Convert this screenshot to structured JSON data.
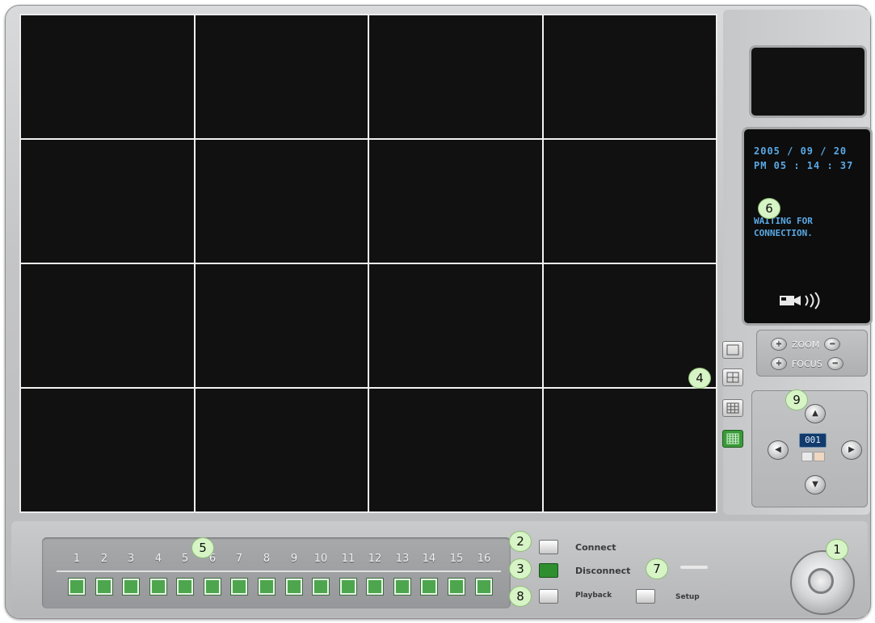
{
  "status": {
    "date": "2005 / 09 / 20",
    "time": "PM 05 : 14 : 37",
    "message": "WAITING FOR CONNECTION."
  },
  "zoom_label": "ZOOM",
  "focus_label": "FOCUS",
  "ptz": {
    "channel": "001"
  },
  "channels": [
    "1",
    "2",
    "3",
    "4",
    "5",
    "6",
    "7",
    "8",
    "9",
    "10",
    "11",
    "12",
    "13",
    "14",
    "15",
    "16"
  ],
  "actions": {
    "connect": "Connect",
    "disconnect": "Disconnect",
    "playback": "Playback",
    "setup": "Setup"
  },
  "callouts": [
    "1",
    "2",
    "3",
    "4",
    "5",
    "6",
    "7",
    "8",
    "9"
  ],
  "colors": {
    "channel_active": "#4da64d",
    "status_text": "#5aa9e6",
    "screen_bg": "#111111"
  },
  "icons": [
    "power-icon",
    "camera-audio-icon",
    "zoom-in-icon",
    "zoom-out-icon",
    "focus-in-icon",
    "focus-out-icon",
    "ptz-up-icon",
    "ptz-down-icon",
    "ptz-left-icon",
    "ptz-right-icon"
  ]
}
